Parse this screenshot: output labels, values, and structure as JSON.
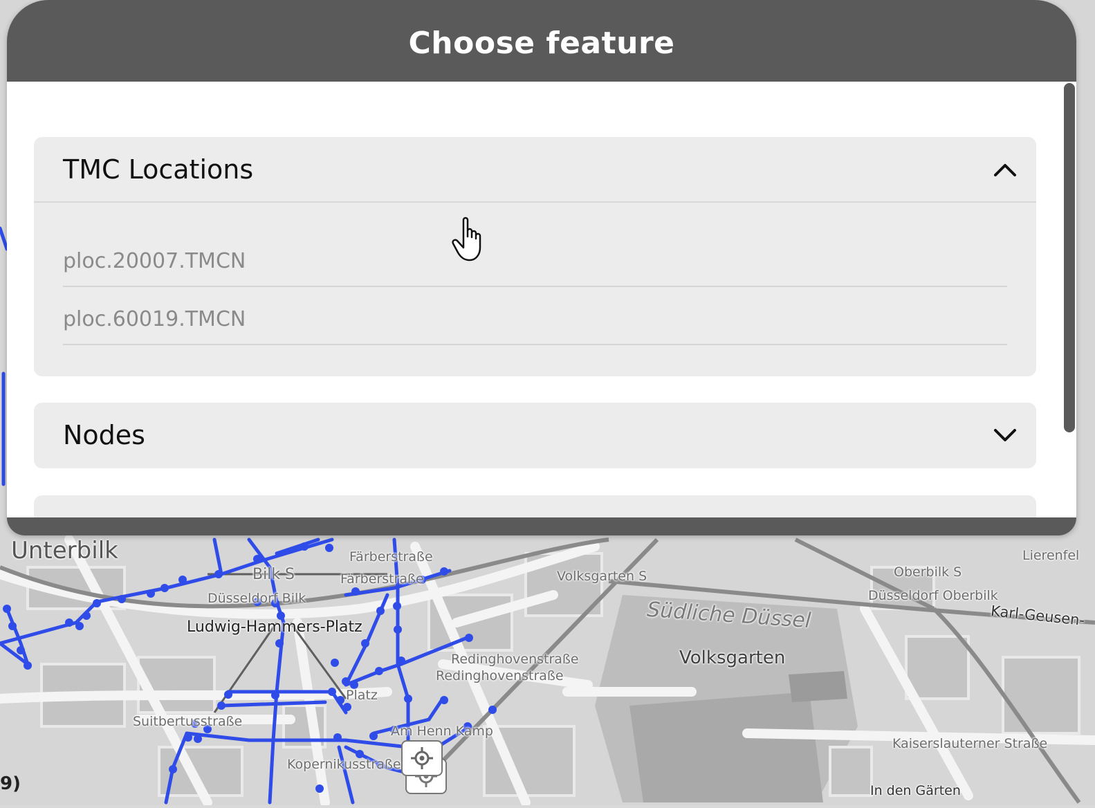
{
  "dialog": {
    "title": "Choose feature",
    "groups": [
      {
        "title": "TMC Locations",
        "expanded": true,
        "chevron_icon": "chevron-up-icon",
        "items": [
          "ploc.20007.TMCN",
          "ploc.60019.TMCN"
        ]
      },
      {
        "title": "Nodes",
        "expanded": false,
        "chevron_icon": "chevron-down-icon",
        "items": []
      },
      {
        "title": "",
        "expanded": false,
        "items": []
      }
    ]
  },
  "map": {
    "labels": {
      "unterbilk": "Unterbilk",
      "farberstrasse1": "Färberstraße",
      "farberstrasse2": "Färberstraße",
      "bilk_s": "Bilk S",
      "dusseldorf_bilk": "Düsseldorf Bilk",
      "ludwig": "Ludwig-Hammers-Platz",
      "volksgarten_s": "Volksgarten S",
      "suedliche_duessel": "Südliche Düssel",
      "volksgarten": "Volksgarten",
      "oberbilk_s": "Oberbilk S",
      "dusseldorf_oberbilk": "Düsseldorf Oberbilk",
      "karl_geusen": "Karl-Geusen-",
      "lierenfeld": "Lierenfel",
      "redinghoven1": "Redinghovenstraße",
      "redinghoven2": "Redinghovenstraße",
      "suitbert": "Suitbertusstraße",
      "platz": "Platz",
      "henn": "Am Henn Kamp",
      "kopernikus": "Kopernikusstraße",
      "kaiserslauterner": "Kaiserslauterner Straße",
      "in_den_garten": "In den Gärten"
    },
    "scale_fragment": "9)",
    "network_color": "#2f4ce8",
    "locate_icon": "crosshair-icon"
  }
}
